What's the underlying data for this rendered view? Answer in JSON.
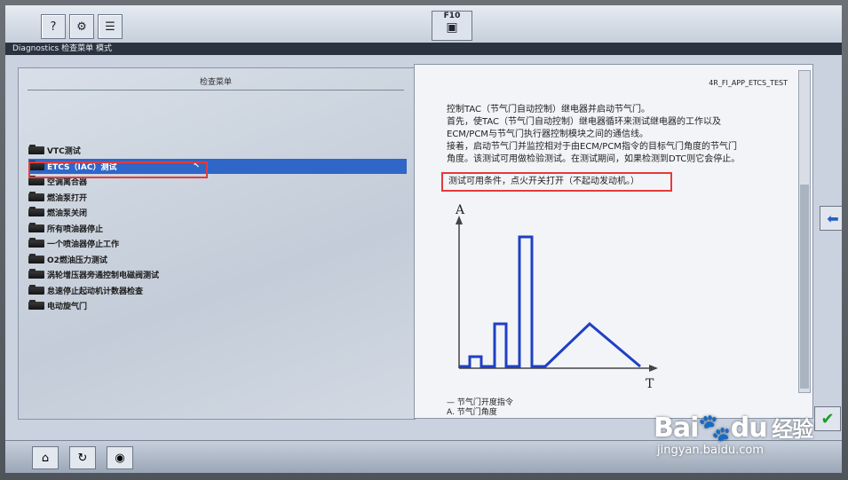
{
  "toolbar": {
    "f10_label": "F10",
    "title_strip": "Diagnostics 检查菜单 模式"
  },
  "left_panel": {
    "header": "检查菜单",
    "items": [
      {
        "label": "VTC测试",
        "selected": false
      },
      {
        "label": "ETCS（IAC）测试",
        "selected": true
      },
      {
        "label": "空调离合器",
        "selected": false
      },
      {
        "label": "燃油泵打开",
        "selected": false
      },
      {
        "label": "燃油泵关闭",
        "selected": false
      },
      {
        "label": "所有喷油器停止",
        "selected": false
      },
      {
        "label": "一个喷油器停止工作",
        "selected": false
      },
      {
        "label": "O2燃油压力测试",
        "selected": false
      },
      {
        "label": "涡轮增压器旁通控制电磁阀测试",
        "selected": false
      },
      {
        "label": "怠速停止起动机计数器检查",
        "selected": false
      },
      {
        "label": "电动旋气门",
        "selected": false
      }
    ]
  },
  "right_panel": {
    "test_code": "4R_FI_APP_ETCS_TEST",
    "description": [
      "控制TAC（节气门自动控制）继电器并启动节气门。",
      "首先，使TAC（节气门自动控制）继电器循环来测试继电器的工作以及",
      "ECM/PCM与节气门执行器控制模块之间的通信线。",
      "接着，启动节气门并监控相对于由ECM/PCM指令的目标气门角度的节气门",
      "角度。该测试可用做检验测试。在测试期间，如果检测到DTC则它会停止。"
    ],
    "condition": "测试可用条件，点火开关打开（不起动发动机。）",
    "graph": {
      "y_axis_label": "A",
      "x_axis_label": "T"
    },
    "legend": {
      "line1": "— 节气门开度指令",
      "line2": "A. 节气门角度"
    }
  },
  "watermark": {
    "brand_a": "Bai",
    "brand_b": "du",
    "brand_cn": "经验",
    "url": "jingyan.baidu.com"
  },
  "colors": {
    "selection": "#2f66c8",
    "highlight_box": "#e43a3a",
    "graph_line": "#1f3fc4"
  }
}
